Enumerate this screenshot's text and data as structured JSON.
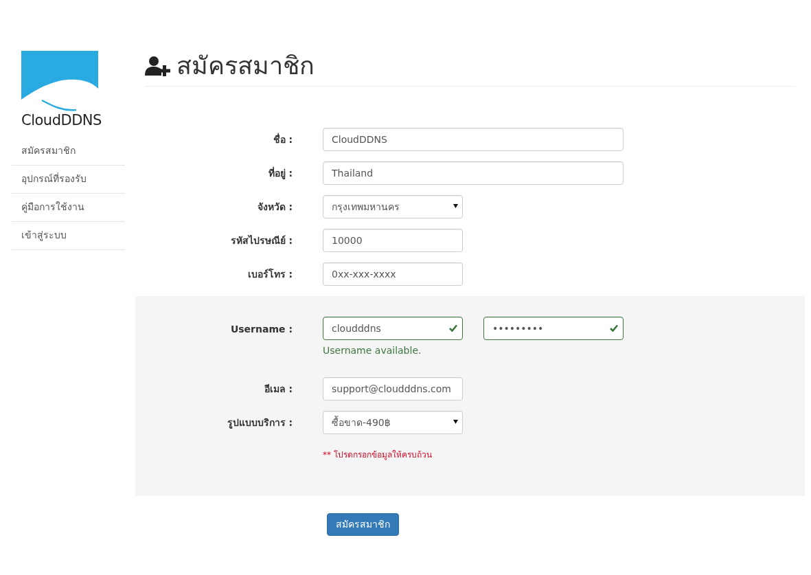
{
  "sidebar": {
    "brand": "CloudDDNS",
    "items": [
      {
        "label": "สมัครสมาชิก"
      },
      {
        "label": "อุปกรณ์ที่รองรับ"
      },
      {
        "label": "คู่มือการใช้งาน"
      },
      {
        "label": "เข้าสู่ระบบ"
      }
    ]
  },
  "heading": "สมัครสมาชิก",
  "fields": [
    {
      "label": "ชื่อ :",
      "kind": "text",
      "value": "CloudDDNS"
    },
    {
      "label": "ที่อยู่ :",
      "kind": "text",
      "value": "Thailand"
    },
    {
      "label": "จังหวัด :",
      "kind": "select",
      "value": "กรุงเทพมหานคร"
    },
    {
      "label": "รหัสไปรษณีย์ :",
      "kind": "text",
      "value": "10000"
    },
    {
      "label": "เบอร์โทร :",
      "kind": "text",
      "value": "0xx-xxx-xxxx"
    }
  ],
  "account": {
    "username": {
      "label": "Username :",
      "value": "cloudddns",
      "valid": true,
      "help": "Username available."
    },
    "password": {
      "value": "•••••••••",
      "valid": true
    },
    "fields": [
      {
        "label": "อีเมล :",
        "kind": "text",
        "value": "support@cloudddns.com"
      },
      {
        "label": "รูปแบบบริการ :",
        "kind": "select",
        "value": "ซื้อขาด-490฿"
      }
    ],
    "note": "** โปรดกรอกข้อมูลให้ครบถ้วน"
  },
  "submit": "สมัครสมาชิก"
}
